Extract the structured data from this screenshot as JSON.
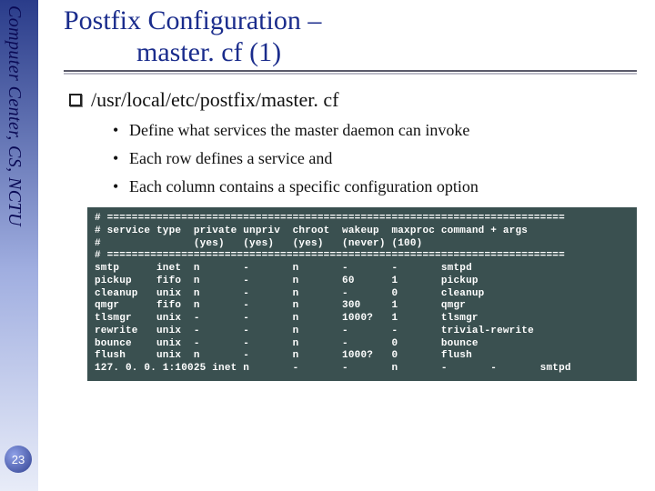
{
  "sidebar": {
    "label": "Computer Center, CS, NCTU"
  },
  "page_number": "23",
  "title": {
    "line1": "Postfix Configuration –",
    "line2": "master. cf (1)"
  },
  "heading": "/usr/local/etc/postfix/master. cf",
  "bullets": [
    "Define what services the master daemon can invoke",
    "Each row defines a service and",
    "Each column contains a specific configuration option"
  ],
  "code": {
    "rule": "# ==========================================================================",
    "hdr1": "# service type  private unpriv  chroot  wakeup  maxproc command + args",
    "hdr2": "#               (yes)   (yes)   (yes)   (never) (100)",
    "rows": [
      "smtp      inet  n       -       n       -       -       smtpd",
      "pickup    fifo  n       -       n       60      1       pickup",
      "cleanup   unix  n       -       n       -       0       cleanup",
      "qmgr      fifo  n       -       n       300     1       qmgr",
      "tlsmgr    unix  -       -       n       1000?   1       tlsmgr",
      "rewrite   unix  -       -       n       -       -       trivial-rewrite",
      "bounce    unix  -       -       n       -       0       bounce",
      "flush     unix  n       -       n       1000?   0       flush",
      "127. 0. 0. 1:10025 inet n       -       -       n       -       -       smtpd"
    ]
  }
}
